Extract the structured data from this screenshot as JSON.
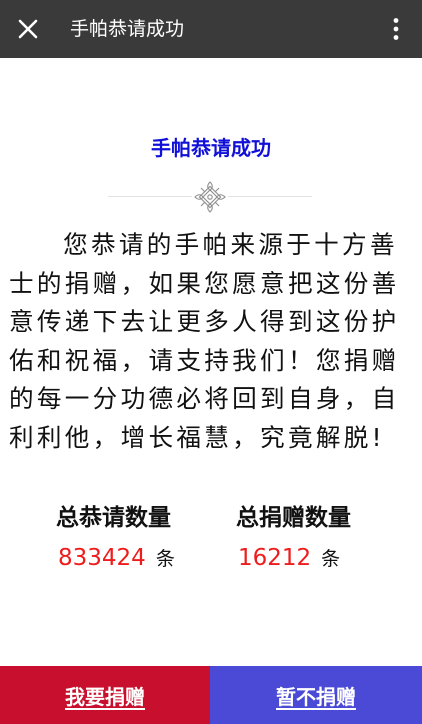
{
  "header": {
    "title": "手帕恭请成功",
    "close_icon": "close-icon",
    "menu_icon": "more-vertical-icon"
  },
  "content": {
    "title": "手帕恭请成功",
    "divider_icon": "endless-knot-ornament-icon",
    "body": "您恭请的手帕来源于十方善士的捐赠，如果您愿意把这份善意传递下去让更多人得到这份护佑和祝福，请支持我们！您捐赠的每一分功德必将回到自身，自利利他，增长福慧，究竟解脱!"
  },
  "stats": {
    "total_greets": {
      "label": "总恭请数量",
      "value": "833424",
      "unit": "条"
    },
    "total_donations": {
      "label": "总捐赠数量",
      "value": "16212",
      "unit": "条"
    }
  },
  "actions": {
    "donate_label": "我要捐赠",
    "skip_label": "暂不捐赠"
  },
  "colors": {
    "header_bg": "#3a3a3a",
    "title_blue": "#1010d8",
    "value_red": "#ee1c1c",
    "donate_bg": "#c8102e",
    "skip_bg": "#4a4ad6"
  }
}
